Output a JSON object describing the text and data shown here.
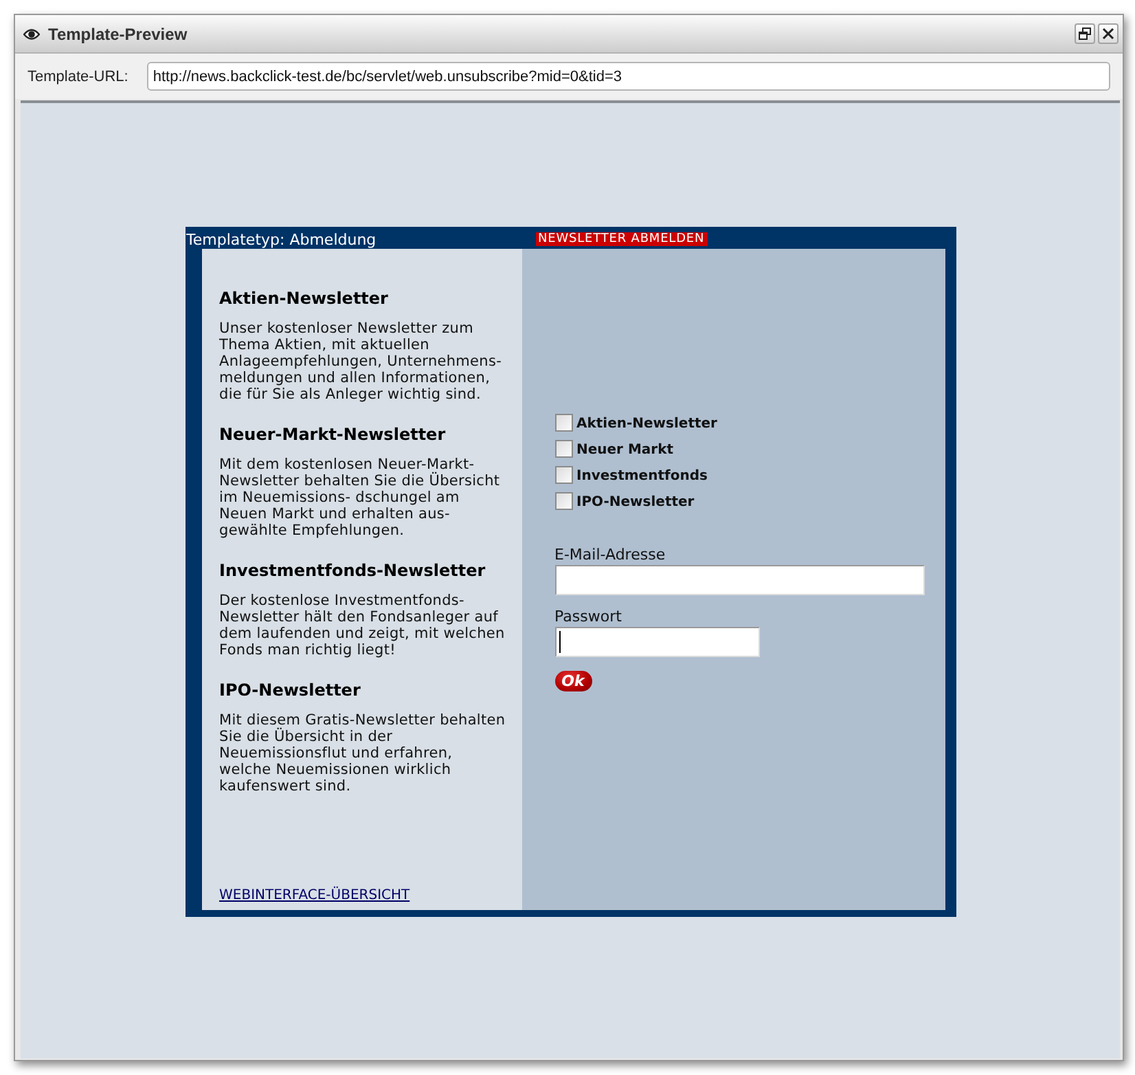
{
  "window": {
    "title": "Template-Preview"
  },
  "url_bar": {
    "label": "Template-URL:",
    "value": "http://news.backclick-test.de/bc/servlet/web.unsubscribe?mid=0&tid=3"
  },
  "template": {
    "type_label": "Templatetyp: Abmeldung",
    "badge": "NEWSLETTER ABMELDEN",
    "newsletters": [
      {
        "title": "Aktien-Newsletter",
        "description": "Unser kostenloser Newsletter zum Thema Aktien, mit aktuellen Anlageempfehlungen, Unternehmens- meldungen und allen Informationen, die für Sie als Anleger wichtig sind."
      },
      {
        "title": "Neuer-Markt-Newsletter",
        "description": "Mit dem kostenlosen Neuer-Markt-Newsletter behalten Sie die Übersicht im Neuemissions- dschungel am Neuen Markt und erhalten aus- gewählte Empfehlungen."
      },
      {
        "title": "Investmentfonds-Newsletter",
        "description": "Der kostenlose Investmentfonds-Newsletter hält den Fondsanleger auf dem laufenden und zeigt, mit welchen Fonds man richtig liegt!"
      },
      {
        "title": "IPO-Newsletter",
        "description": "Mit diesem Gratis-Newsletter behalten Sie die Übersicht in der Neuemissionsflut und erfahren, welche Neuemissionen wirklich kaufenswert sind."
      }
    ],
    "overview_link": "WEBINTERFACE-ÜBERSICHT",
    "checkboxes": [
      {
        "label": "Aktien-Newsletter",
        "checked": false
      },
      {
        "label": "Neuer Markt",
        "checked": false
      },
      {
        "label": "Investmentfonds",
        "checked": false
      },
      {
        "label": "IPO-Newsletter",
        "checked": false
      }
    ],
    "email_field": {
      "label": "E-Mail-Adresse"
    },
    "password_field": {
      "label": "Passwort",
      "focused": true
    },
    "submit_button": {
      "label": "Ok"
    }
  }
}
